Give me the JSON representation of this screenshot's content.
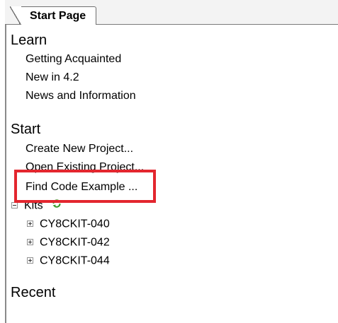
{
  "tab": {
    "title": "Start Page"
  },
  "learn": {
    "heading": "Learn",
    "items": [
      {
        "label": "Getting Acquainted"
      },
      {
        "label": "New in 4.2"
      },
      {
        "label": "News and Information"
      }
    ]
  },
  "start": {
    "heading": "Start",
    "items": [
      {
        "label": "Create New Project..."
      },
      {
        "label": "Open Existing Project..."
      },
      {
        "label": "Find Code Example ..."
      }
    ]
  },
  "kits": {
    "label": "Kits",
    "expanded": true,
    "refresh_icon": "refresh-icon",
    "items": [
      {
        "label": "CY8CKIT-040"
      },
      {
        "label": "CY8CKIT-042"
      },
      {
        "label": "CY8CKIT-044"
      }
    ]
  },
  "recent": {
    "heading": "Recent"
  },
  "colors": {
    "highlight": "#e3262e",
    "refresh_green": "#3a9a2c",
    "tab_border": "#6f6f6f"
  }
}
